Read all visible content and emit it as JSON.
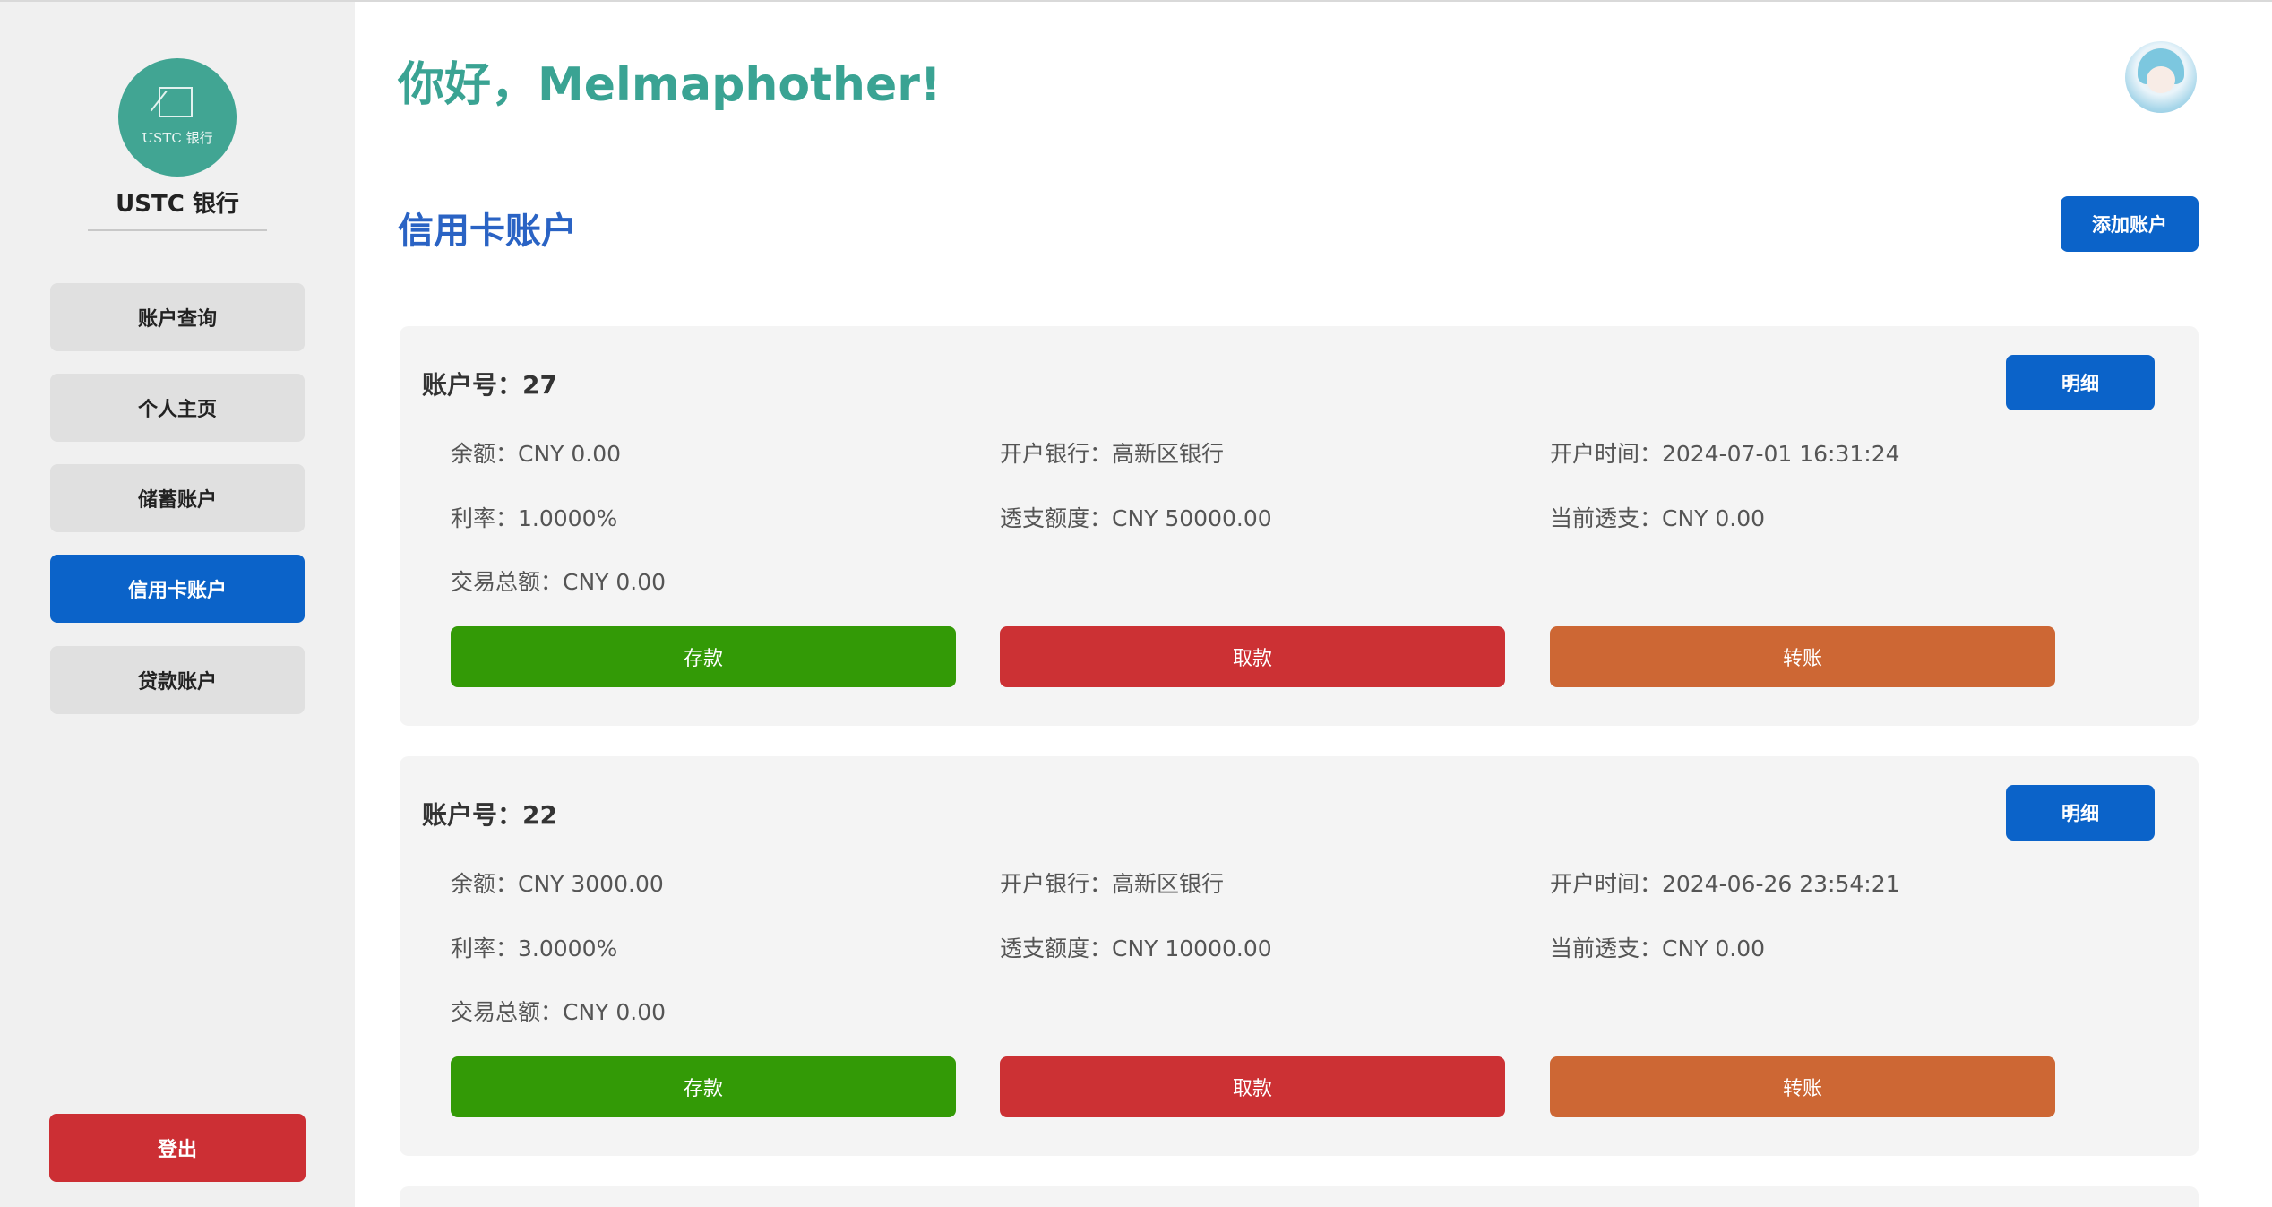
{
  "brand": {
    "logo_text": "USTC 银行",
    "name": "USTC 银行"
  },
  "sidebar": {
    "items": [
      {
        "label": "账户查询",
        "active": false
      },
      {
        "label": "个人主页",
        "active": false
      },
      {
        "label": "储蓄账户",
        "active": false
      },
      {
        "label": "信用卡账户",
        "active": true
      },
      {
        "label": "贷款账户",
        "active": false
      }
    ],
    "logout_label": "登出"
  },
  "header": {
    "greeting": "你好，Melmaphother!"
  },
  "section": {
    "title": "信用卡账户",
    "add_button": "添加账户"
  },
  "accounts": [
    {
      "title": "账户号：27",
      "detail_button": "明细",
      "balance": "余额：CNY 0.00",
      "bank": "开户银行：高新区银行",
      "open_time": "开户时间：2024-07-01 16:31:24",
      "rate": "利率：1.0000%",
      "overdraft_limit": "透支额度：CNY 50000.00",
      "current_overdraft": "当前透支：CNY 0.00",
      "total_transactions": "交易总额：CNY 0.00",
      "deposit_button": "存款",
      "withdraw_button": "取款",
      "transfer_button": "转账"
    },
    {
      "title": "账户号：22",
      "detail_button": "明细",
      "balance": "余额：CNY 3000.00",
      "bank": "开户银行：高新区银行",
      "open_time": "开户时间：2024-06-26 23:54:21",
      "rate": "利率：3.0000%",
      "overdraft_limit": "透支额度：CNY 10000.00",
      "current_overdraft": "当前透支：CNY 0.00",
      "total_transactions": "交易总额：CNY 0.00",
      "deposit_button": "存款",
      "withdraw_button": "取款",
      "transfer_button": "转账"
    }
  ],
  "colors": {
    "brand_teal": "#3aa393",
    "primary_blue": "#0b63c9",
    "deposit_green": "#339a06",
    "withdraw_red": "#cc3134",
    "transfer_orange": "#cd6734",
    "logout_red": "#cc2f34"
  }
}
